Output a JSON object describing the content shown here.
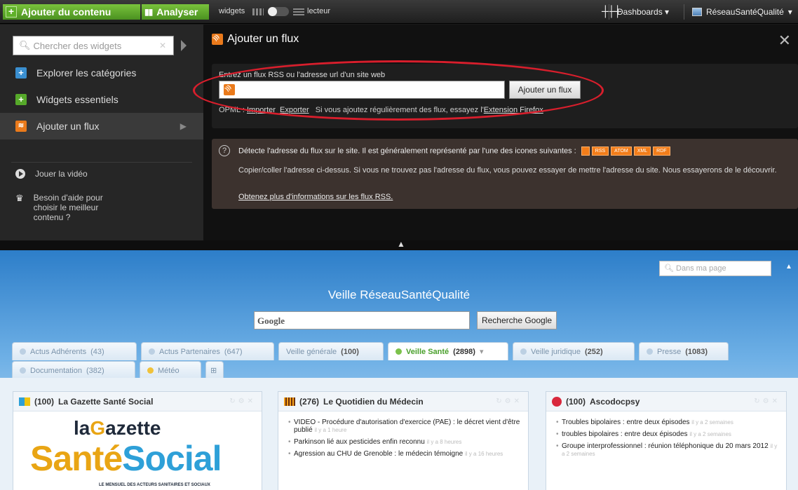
{
  "topbar": {
    "add_content": "Ajouter du contenu",
    "analyze": "Analyser",
    "widgets": "widgets",
    "reader": "lecteur",
    "dashboards": "Dashboards",
    "user": "RéseauSantéQualité"
  },
  "sidebar": {
    "search_placeholder": "Chercher des widgets",
    "items": [
      {
        "label": "Explorer les catégories",
        "icon": "plus-blue-icon"
      },
      {
        "label": "Widgets essentiels",
        "icon": "plus-green-icon"
      },
      {
        "label": "Ajouter un flux",
        "icon": "rss-icon"
      }
    ],
    "video": "Jouer la vidéo",
    "help": "Besoin d'aide pour choisir le meilleur contenu ?"
  },
  "panel": {
    "title": "Ajouter un flux",
    "input_label": "Entrez un flux RSS ou l'adresse url d'un site web",
    "add_button": "Ajouter un flux",
    "opml_prefix": "OPML :",
    "import": "Importer",
    "export": "Exporter",
    "tip": "Si vous ajoutez régulièrement des flux, essayez l'",
    "firefox": "Extension Firefox",
    "detect": "Détecte l'adresse du flux sur le site. Il est généralement représenté par l'une des icones suivantes :",
    "badges": [
      "RSS",
      "ATOM",
      "XML",
      "RDF"
    ],
    "copy_text": "Copier/coller l'adresse ci-dessus. Si vous ne trouvez pas l'adresse du flux, vous pouvez essayer de mettre l'adresse du site. Nous essayerons de le découvrir.",
    "more_link": "Obtenez plus d'informations sur les flux RSS."
  },
  "dashboard": {
    "search_placeholder": "Dans ma page",
    "title": "Veille RéseauSantéQualité",
    "google_logo": "Google",
    "google_button": "Recherche Google",
    "tabs_row1": [
      {
        "name": "Actus Adhérents",
        "count": "(43)"
      },
      {
        "name": "Actus Partenaires",
        "count": "(647)"
      },
      {
        "name": "Veille générale",
        "count": "(100)"
      },
      {
        "name": "Veille Santé",
        "count": "(2898)"
      },
      {
        "name": "Veille juridique",
        "count": "(252)"
      },
      {
        "name": "Presse",
        "count": "(1083)"
      }
    ],
    "tabs_row2": [
      {
        "name": "Documentation",
        "count": "(382)"
      },
      {
        "name": "Météo",
        "count": ""
      }
    ]
  },
  "cards": [
    {
      "count": "(100)",
      "title": "La Gazette Santé Social",
      "logo_top": "la",
      "logo_g": "G",
      "logo_rest": "azette",
      "logo_a": "Santé",
      "logo_b": "Social",
      "logo_sub": "LE MENSUEL DES ACTEURS SANITAIRES ET SOCIAUX"
    },
    {
      "count": "(276)",
      "title": "Le Quotidien du Médecin",
      "items": [
        {
          "text": "VIDEO - Procédure d'autorisation d'exercice (PAE) : le décret vient d'être publié",
          "meta": "il y a 1 heure"
        },
        {
          "text": "Parkinson lié aux pesticides enfin reconnu",
          "meta": "il y a 8 heures"
        },
        {
          "text": "Agression au CHU de Grenoble : le médecin témoigne",
          "meta": "il y a 16 heures"
        }
      ]
    },
    {
      "count": "(100)",
      "title": "Ascodocpsy",
      "items": [
        {
          "text": "Troubles bipolaires : entre deux épisodes",
          "meta": "il y a 2 semaines"
        },
        {
          "text": "troubles bipolaires : entre deux épisodes",
          "meta": "il y a 2 semaines"
        },
        {
          "text": "Groupe interprofessionnel : réunion téléphonique du 20 mars 2012",
          "meta": "il y a 2 semaines"
        }
      ]
    }
  ]
}
